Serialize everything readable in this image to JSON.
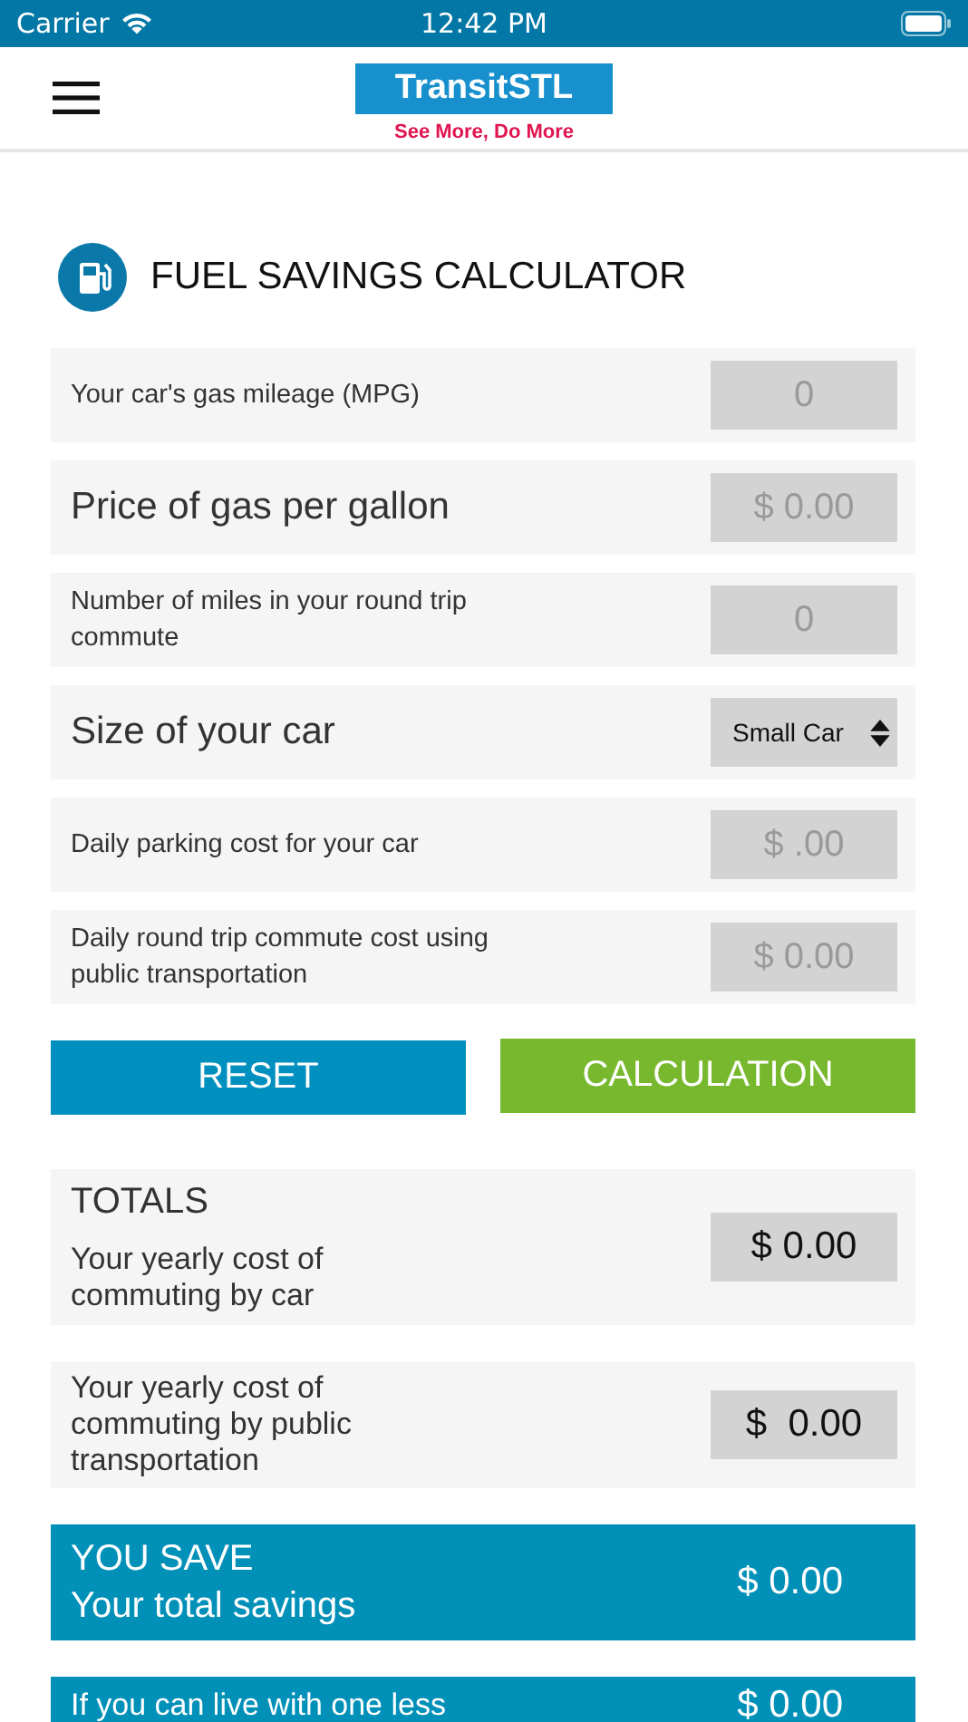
{
  "status_bar": {
    "carrier": "Carrier",
    "time": "12:42 PM"
  },
  "header": {
    "logo": "TransitSTL",
    "tagline": "See More, Do More"
  },
  "title": "FUEL SAVINGS CALCULATOR",
  "fields": [
    {
      "kind": "input",
      "label": "Your car's gas mileage (MPG)",
      "placeholder": "0",
      "large": false
    },
    {
      "kind": "input",
      "label": "Price of gas per gallon",
      "placeholder": "$ 0.00",
      "large": true
    },
    {
      "kind": "input",
      "label": "Number of miles in your round trip commute",
      "placeholder": "0",
      "large": false
    },
    {
      "kind": "select",
      "label": "Size of your car",
      "value": "Small Car",
      "large": true
    },
    {
      "kind": "input",
      "label": "Daily parking cost for your car",
      "placeholder": "$ .00",
      "large": false
    },
    {
      "kind": "input",
      "label": "Daily round trip commute cost using public transportation",
      "placeholder": "$ 0.00",
      "large": false
    }
  ],
  "buttons": [
    {
      "label": "RESET",
      "color": "#0090bf"
    },
    {
      "label": "CALCULATION",
      "color": "#77b82e"
    }
  ],
  "totals": {
    "heading": "TOTALS",
    "rows": [
      {
        "label": "Your yearly cost of commuting by car",
        "value": "$ 0.00"
      },
      {
        "label": "Your yearly cost of commuting by public transportation",
        "value": "$  0.00"
      }
    ]
  },
  "savings": [
    {
      "heading": "YOU SAVE",
      "label": "Your total savings",
      "value": "$ 0.00"
    },
    {
      "label": "If you can live with one less",
      "value": "$ 0.00"
    }
  ]
}
